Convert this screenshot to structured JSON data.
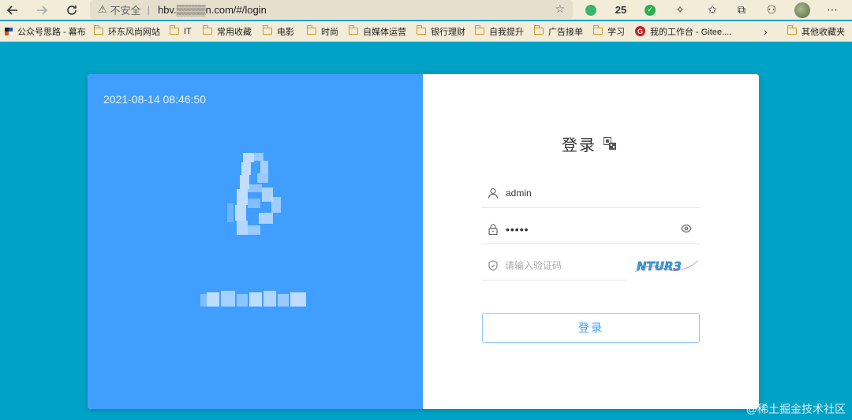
{
  "browser": {
    "security_label": "不安全",
    "url": "hbv.▒▒▒▒n.com/#/login",
    "extension_badge": "25"
  },
  "bookmarks": [
    {
      "label": "公众号思路 - 幕布",
      "icon": "mubu-icon"
    },
    {
      "label": "环东风尚网站",
      "icon": "folder-icon"
    },
    {
      "label": "IT",
      "icon": "folder-icon"
    },
    {
      "label": "常用收藏",
      "icon": "folder-icon"
    },
    {
      "label": "电影",
      "icon": "folder-icon"
    },
    {
      "label": "时尚",
      "icon": "folder-icon"
    },
    {
      "label": "自媒体运营",
      "icon": "folder-icon"
    },
    {
      "label": "银行理财",
      "icon": "folder-icon"
    },
    {
      "label": "自我提升",
      "icon": "folder-icon"
    },
    {
      "label": "广告接单",
      "icon": "folder-icon"
    },
    {
      "label": "学习",
      "icon": "folder-icon"
    },
    {
      "label": "我的工作台 - Gitee....",
      "icon": "gitee-icon"
    }
  ],
  "other_bookmarks": "其他收藏夹",
  "login": {
    "datetime": "2021-08-14 08:46:50",
    "title": "登录",
    "username": "admin",
    "password": "•••••",
    "captcha_placeholder": "请输入验证码",
    "captcha_text": "NTUR3",
    "button_label": "登录"
  },
  "watermark": "@稀土掘金技术社区",
  "colors": {
    "page_bg": "#00a2c6",
    "left_panel": "#409eff",
    "accent": "#409eff",
    "browser_bar": "#f3ecd9"
  }
}
